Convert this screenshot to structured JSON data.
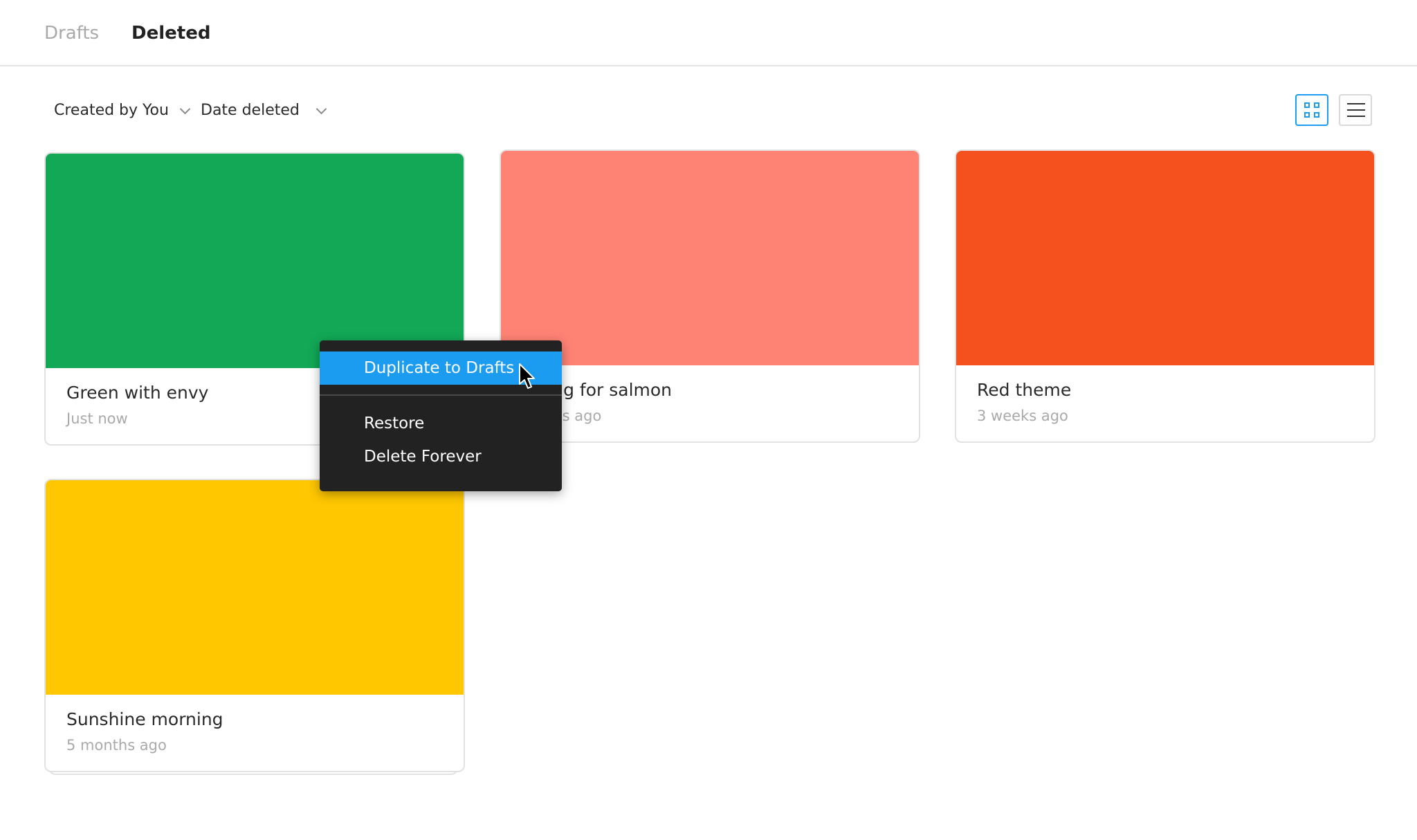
{
  "tabs": {
    "drafts": "Drafts",
    "deleted": "Deleted"
  },
  "filters": {
    "owner": "Created by You",
    "sort": "Date deleted"
  },
  "view_mode": "grid",
  "cards": [
    {
      "title": "Green with envy",
      "meta": "Just  now",
      "color": "#12a856"
    },
    {
      "title": "Pining for salmon",
      "meta": "3 days ago",
      "color": "#ff8375"
    },
    {
      "title": "Red theme",
      "meta": "3 weeks ago",
      "color": "#f4511e"
    },
    {
      "title": "Sunshine morning",
      "meta": "5 months ago",
      "color": "#fec700"
    }
  ],
  "context_menu": {
    "duplicate": "Duplicate to Drafts",
    "restore": "Restore",
    "delete": "Delete Forever"
  },
  "colors": {
    "accent": "#1b9cf0",
    "menu_bg": "#222222"
  },
  "icons": {
    "grid_view": "grid-icon",
    "list_view": "list-icon",
    "cursor": "arrow-cursor-icon"
  }
}
